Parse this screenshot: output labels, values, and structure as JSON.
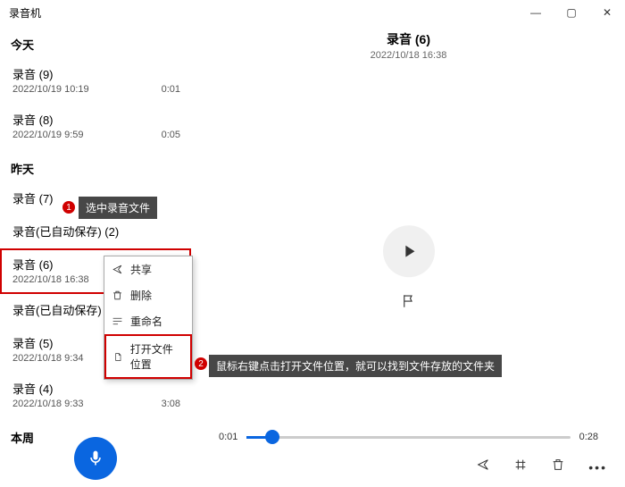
{
  "app_title": "录音机",
  "window": {
    "min": "—",
    "max": "▢",
    "close": "✕"
  },
  "sections": {
    "today": "今天",
    "yesterday": "昨天",
    "thisweek": "本周"
  },
  "items": {
    "r9": {
      "name": "录音 (9)",
      "date": "2022/10/19 10:19",
      "dur": "0:01"
    },
    "r8": {
      "name": "录音 (8)",
      "date": "2022/10/19 9:59",
      "dur": "0:05"
    },
    "r7": {
      "name": "录音 (7)",
      "date": "",
      "dur": ""
    },
    "g2": {
      "name": "录音(已自动保存) (2)",
      "date": "",
      "dur": ""
    },
    "r6": {
      "name": "录音 (6)",
      "date": "2022/10/18 16:38",
      "dur": ""
    },
    "g0": {
      "name": "录音(已自动保存)",
      "date": "",
      "dur": ""
    },
    "r5": {
      "name": "录音 (5)",
      "date": "2022/10/18 9:34",
      "dur": "0:04"
    },
    "r4": {
      "name": "录音 (4)",
      "date": "2022/10/18 9:33",
      "dur": "3:08"
    }
  },
  "context_menu": {
    "share": "共享",
    "delete": "删除",
    "rename": "重命名",
    "open_location": "打开文件位置"
  },
  "detail": {
    "name": "录音 (6)",
    "date": "2022/10/18 16:38",
    "time_left": "0:01",
    "time_right": "0:28"
  },
  "callouts": {
    "n1": "1",
    "t1": "选中录音文件",
    "n2": "2",
    "t2": "鼠标右键点击打开文件位置，就可以找到文件存放的文件夹"
  }
}
